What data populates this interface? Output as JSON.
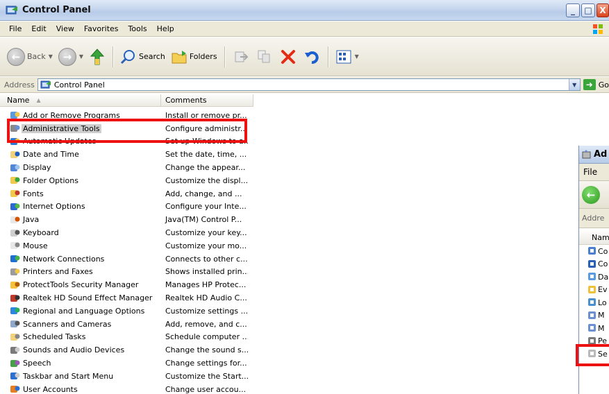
{
  "window": {
    "title": "Control Panel",
    "minimize_label": "_",
    "maximize_label": "□",
    "close_label": "X"
  },
  "menubar": [
    "File",
    "Edit",
    "View",
    "Favorites",
    "Tools",
    "Help"
  ],
  "toolbar": {
    "back_label": "Back",
    "search_label": "Search",
    "folders_label": "Folders"
  },
  "address": {
    "label": "Address",
    "value": "Control Panel",
    "go_label": "Go"
  },
  "columns": {
    "name": "Name",
    "comments": "Comments"
  },
  "items": [
    {
      "name": "Add or Remove Programs",
      "comment": "Install or remove pr..."
    },
    {
      "name": "Administrative Tools",
      "comment": "Configure administr..."
    },
    {
      "name": "Automatic Updates",
      "comment": "Set up Windows to a..."
    },
    {
      "name": "Date and Time",
      "comment": "Set the date, time, ..."
    },
    {
      "name": "Display",
      "comment": "Change the appear..."
    },
    {
      "name": "Folder Options",
      "comment": "Customize the displ..."
    },
    {
      "name": "Fonts",
      "comment": "Add, change, and ..."
    },
    {
      "name": "Internet Options",
      "comment": "Configure your Inte..."
    },
    {
      "name": "Java",
      "comment": "Java(TM) Control P..."
    },
    {
      "name": "Keyboard",
      "comment": "Customize your key..."
    },
    {
      "name": "Mouse",
      "comment": "Customize your mo..."
    },
    {
      "name": "Network Connections",
      "comment": "Connects to other c..."
    },
    {
      "name": "Printers and Faxes",
      "comment": "Shows installed prin..."
    },
    {
      "name": "ProtectTools Security Manager",
      "comment": "Manages HP Protec..."
    },
    {
      "name": "Realtek HD Sound Effect Manager",
      "comment": "Realtek HD Audio C..."
    },
    {
      "name": "Regional and Language Options",
      "comment": "Customize settings ..."
    },
    {
      "name": "Scanners and Cameras",
      "comment": "Add, remove, and c..."
    },
    {
      "name": "Scheduled Tasks",
      "comment": "Schedule computer ..."
    },
    {
      "name": "Sounds and Audio Devices",
      "comment": "Change the sound s..."
    },
    {
      "name": "Speech",
      "comment": "Change settings for..."
    },
    {
      "name": "Taskbar and Start Menu",
      "comment": "Customize the Start..."
    },
    {
      "name": "User Accounts",
      "comment": "Change user accou..."
    }
  ],
  "admin_window": {
    "title": "Ad",
    "menu_first": "File",
    "address_label": "Addre",
    "column_name": "Nam",
    "rows": [
      "Co",
      "Co",
      "Da",
      "Ev",
      "Lo",
      "M",
      "M",
      "Pe",
      "Se"
    ]
  },
  "colors": {
    "highlight": "#ee1111",
    "selection": "#cecece",
    "chrome": "#ece9d8"
  }
}
